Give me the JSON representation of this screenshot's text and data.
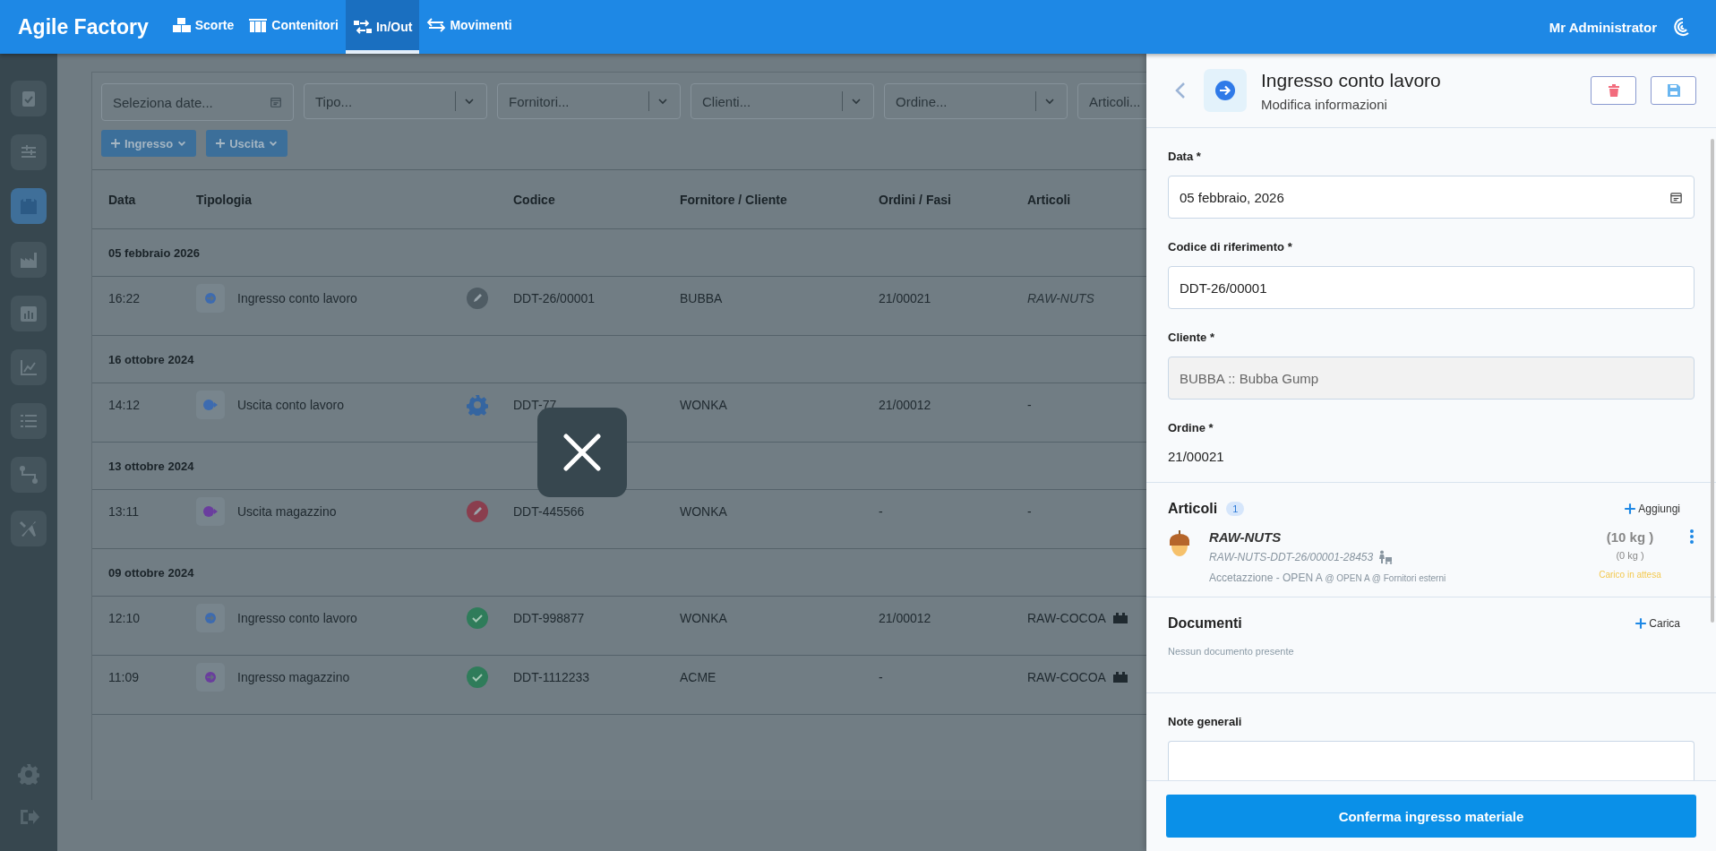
{
  "app": {
    "name": "Agile Factory"
  },
  "nav": [
    {
      "label": "Scorte",
      "selected": false
    },
    {
      "label": "Contenitori",
      "selected": false
    },
    {
      "label": "In/Out",
      "selected": true
    },
    {
      "label": "Movimenti",
      "selected": false
    }
  ],
  "user": {
    "name": "Mr Administrator"
  },
  "sidebar": {
    "items": [
      {
        "selected": false
      },
      {
        "selected": false
      },
      {
        "selected": true
      },
      {
        "selected": false
      },
      {
        "selected": false
      },
      {
        "selected": false
      },
      {
        "selected": false
      },
      {
        "selected": false
      },
      {
        "selected": false
      }
    ]
  },
  "filters": [
    {
      "placeholder": "Seleziona date...",
      "kind": "date"
    },
    {
      "placeholder": "Tipo...",
      "kind": "select"
    },
    {
      "placeholder": "Fornitori...",
      "kind": "select"
    },
    {
      "placeholder": "Clienti...",
      "kind": "select"
    },
    {
      "placeholder": "Ordine...",
      "kind": "select"
    },
    {
      "placeholder": "Articoli...",
      "kind": "select_clipped"
    }
  ],
  "actions": [
    {
      "label": "Ingresso"
    },
    {
      "label": "Uscita"
    }
  ],
  "table": {
    "columns": [
      "Data",
      "Tipologia",
      "Codice",
      "Fornitore / Cliente",
      "Ordini / Fasi",
      "Articoli"
    ],
    "groups": [
      {
        "date": "05 febbraio 2026",
        "rows": [
          {
            "time": "16:22",
            "type": "Ingresso conto lavoro",
            "type_icon": {
              "kind": "in",
              "color": "#3d6bb0"
            },
            "status": {
              "kind": "draft"
            },
            "code": "DDT-26/00001",
            "partner": "BUBBA",
            "order": "21/00021",
            "article": "RAW-NUTS",
            "article_italic": true,
            "pallet": false
          }
        ]
      },
      {
        "date": "16 ottobre 2024",
        "rows": [
          {
            "time": "14:12",
            "type": "Uscita conto lavoro",
            "type_icon": {
              "kind": "out",
              "color": "#3d6bb0"
            },
            "status": {
              "kind": "processing"
            },
            "code": "DDT-77",
            "partner": "WONKA",
            "order": "21/00012",
            "article": "-",
            "article_italic": false,
            "pallet": false
          }
        ]
      },
      {
        "date": "13 ottobre 2024",
        "rows": [
          {
            "time": "13:11",
            "type": "Uscita magazzino",
            "type_icon": {
              "kind": "out",
              "color": "#6a3d9e"
            },
            "status": {
              "kind": "rejected"
            },
            "code": "DDT-445566",
            "partner": "WONKA",
            "order": "-",
            "article": "-",
            "article_italic": false,
            "pallet": false
          }
        ]
      },
      {
        "date": "09 ottobre 2024",
        "rows": [
          {
            "time": "12:10",
            "type": "Ingresso conto lavoro",
            "type_icon": {
              "kind": "in",
              "color": "#3d6bb0"
            },
            "status": {
              "kind": "done"
            },
            "code": "DDT-998877",
            "partner": "WONKA",
            "order": "21/00012",
            "article": "RAW-COCOA",
            "article_italic": false,
            "pallet": true
          },
          {
            "time": "11:09",
            "type": "Ingresso magazzino",
            "type_icon": {
              "kind": "in",
              "color": "#6a3d9e"
            },
            "status": {
              "kind": "done"
            },
            "code": "DDT-1112233",
            "partner": "ACME",
            "order": "-",
            "article": "RAW-COCOA",
            "article_italic": false,
            "pallet": true
          }
        ]
      }
    ]
  },
  "panel": {
    "title": "Ingresso conto lavoro",
    "subtitle": "Modifica informazioni",
    "fields": [
      {
        "label": "Data *",
        "value": "05 febbraio, 2026",
        "kind": "date",
        "disabled": false
      },
      {
        "label": "Codice di riferimento *",
        "value": "DDT-26/00001",
        "kind": "text",
        "disabled": false
      },
      {
        "label": "Cliente *",
        "value": "BUBBA :: Bubba Gump",
        "kind": "text",
        "disabled": true
      },
      {
        "label": "Ordine *",
        "value": "21/00021",
        "kind": "static",
        "disabled": false
      }
    ],
    "articles": {
      "title": "Articoli",
      "count": "1",
      "add": "Aggiungi",
      "items": [
        {
          "name": "RAW-NUTS",
          "lot": "RAW-NUTS-DDT-26/00001-28453",
          "phase": "Accetazzione - OPEN A",
          "location": "@ OPEN A @ Fornitori esterni",
          "qty": "(10 kg )",
          "loaded": "(0 kg )",
          "status": "Carico in attesa"
        }
      ]
    },
    "documents": {
      "title": "Documenti",
      "upload": "Carica",
      "empty": "Nessun documento presente"
    },
    "notes": {
      "label": "Note generali"
    },
    "confirm": "Conferma ingresso materiale"
  }
}
